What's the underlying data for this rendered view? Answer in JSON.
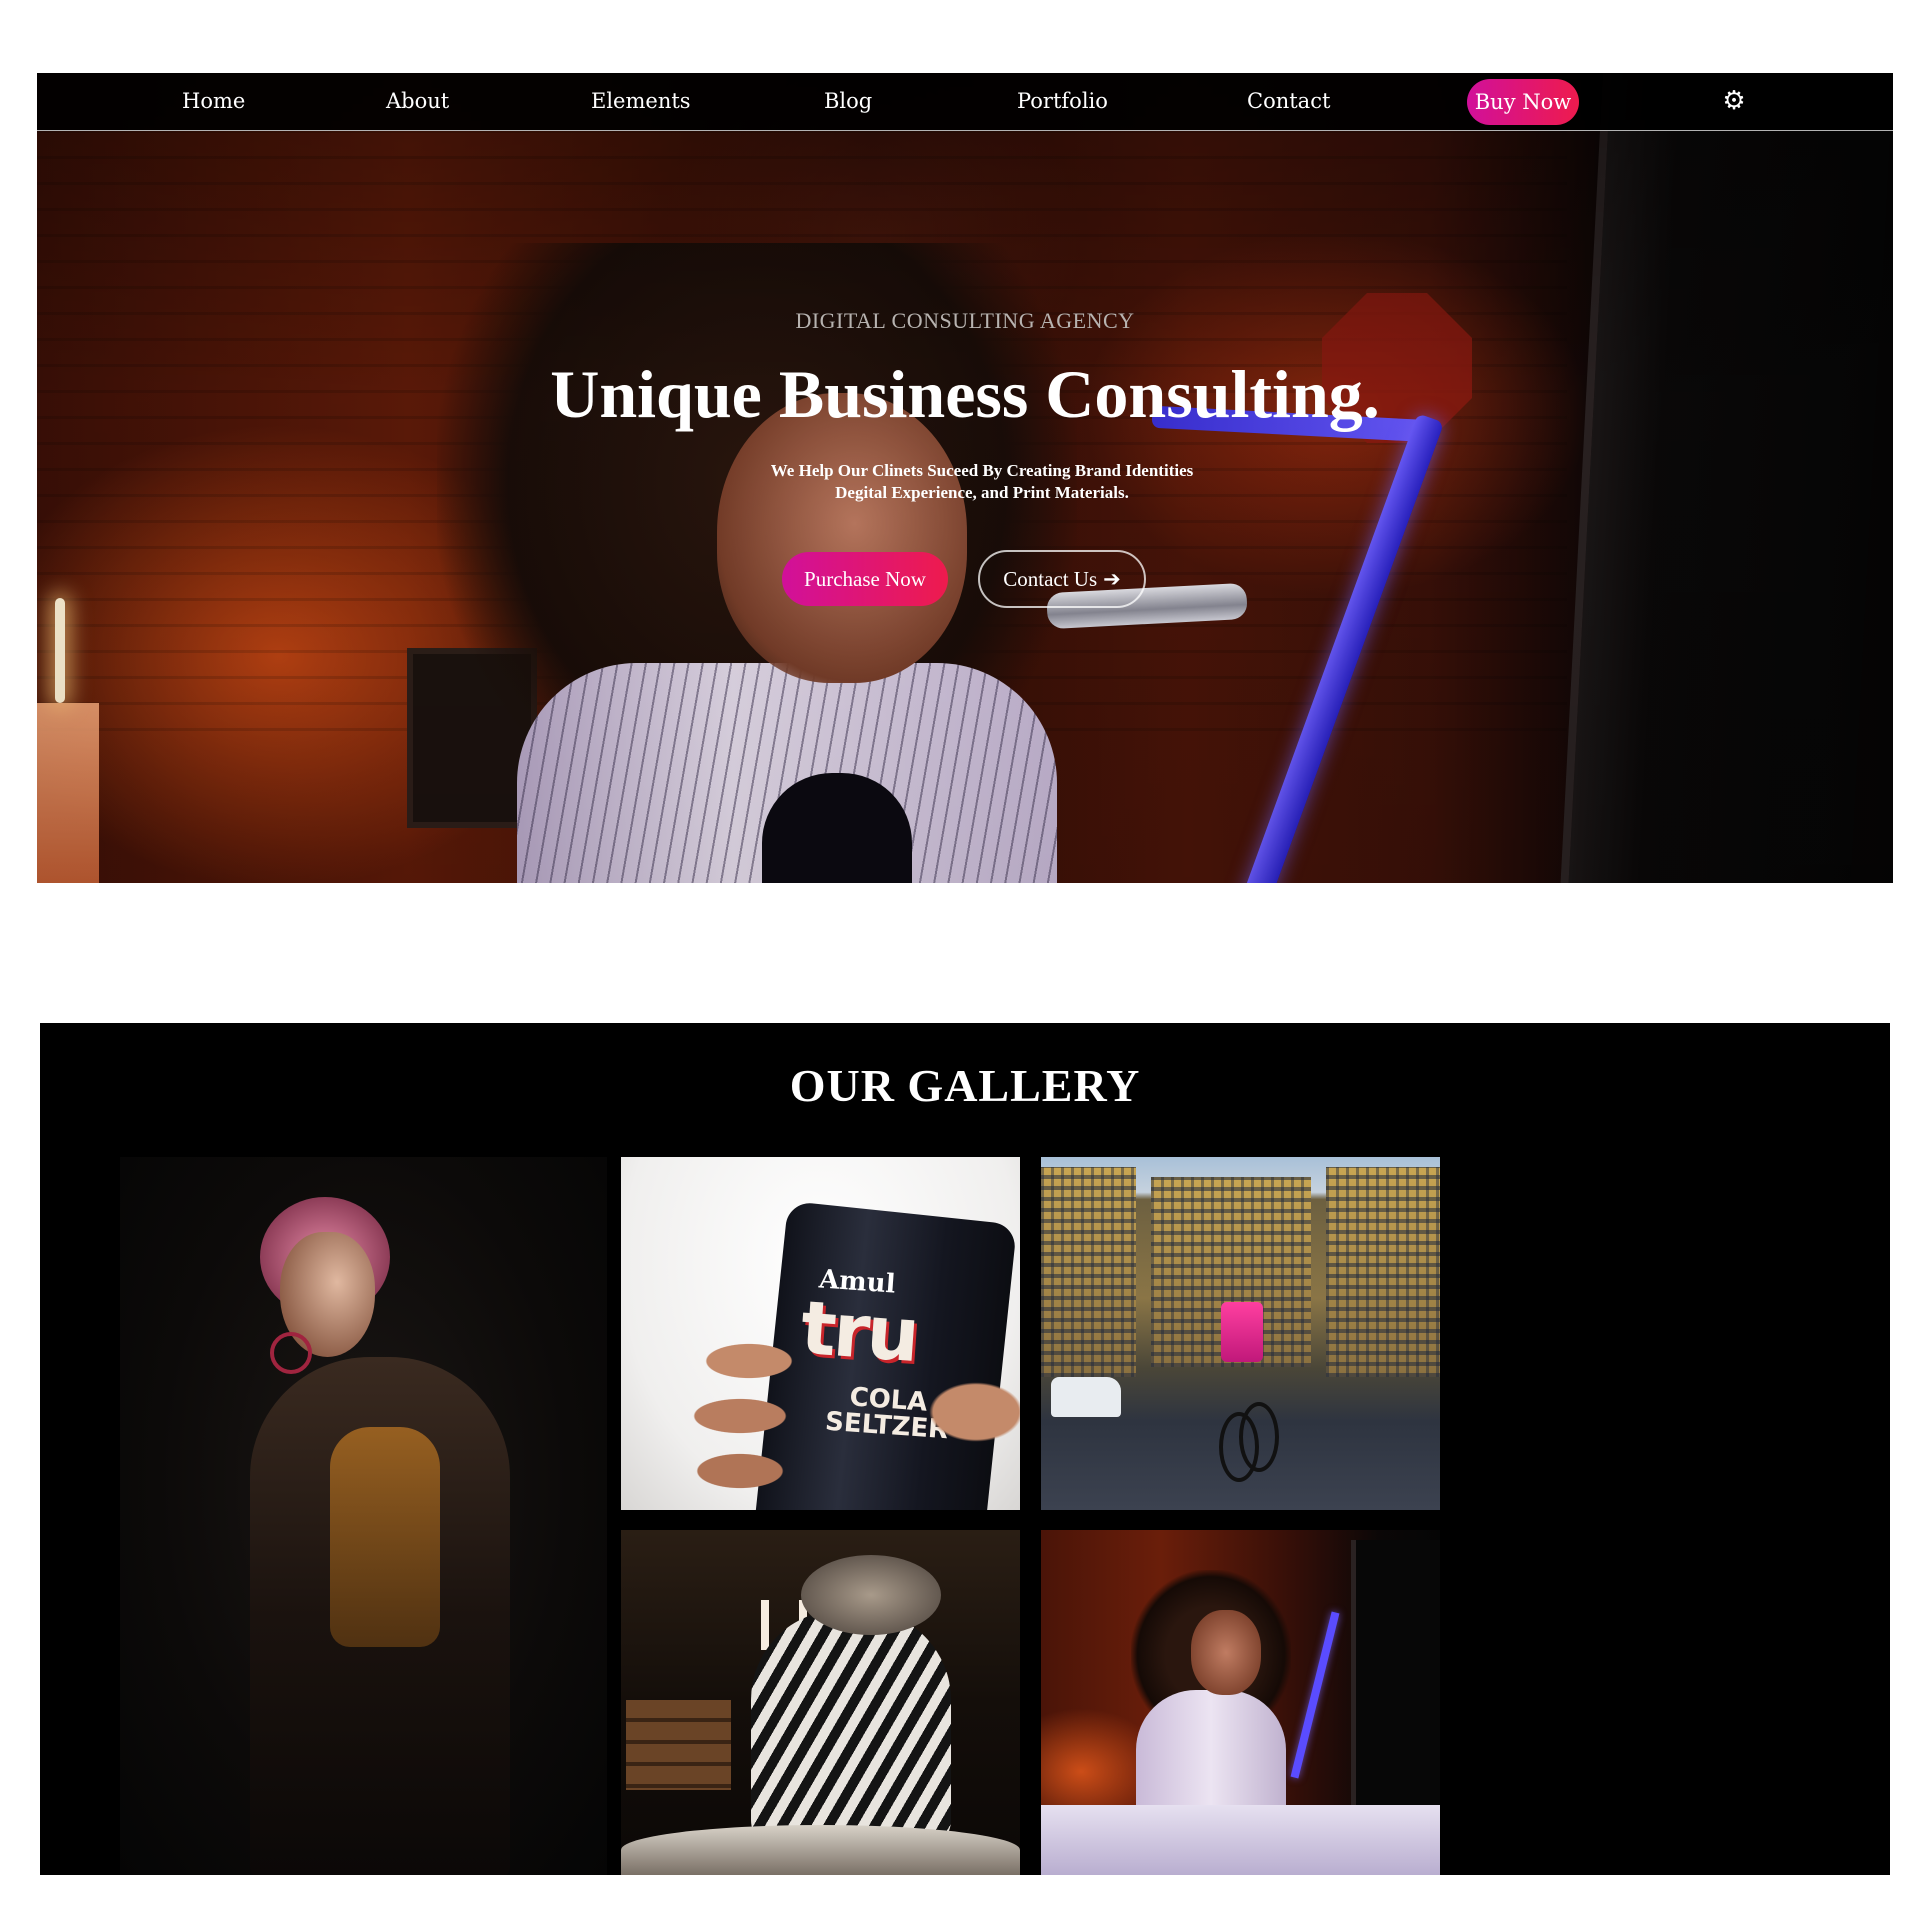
{
  "nav": {
    "links": [
      {
        "label": "Home"
      },
      {
        "label": "About"
      },
      {
        "label": "Elements"
      },
      {
        "label": "Blog"
      },
      {
        "label": "Portfolio"
      },
      {
        "label": "Contact"
      }
    ],
    "buy_label": "Buy Now",
    "settings_icon": "gear-icon"
  },
  "hero": {
    "eyebrow": "DIGITAL CONSULTING AGENCY",
    "title": "Unique Business Consulting.",
    "subtitle_line1": "We Help Our Clinets Suceed By Creating Brand Identities",
    "subtitle_line2": "Degital Experience, and Print Materials.",
    "primary_button": "Purchase Now",
    "secondary_button": "Contact Us",
    "secondary_icon": "arrow-right-icon"
  },
  "gallery": {
    "title": "OUR GALLERY",
    "can_text": {
      "brand": "Amul",
      "big": "tru",
      "line1": "COLA",
      "line2": "SELTZER"
    }
  },
  "colors": {
    "accent_gradient_start": "#d1109a",
    "accent_gradient_end": "#ee1b4d",
    "nav_background": "#000000",
    "gallery_background": "#000000"
  }
}
